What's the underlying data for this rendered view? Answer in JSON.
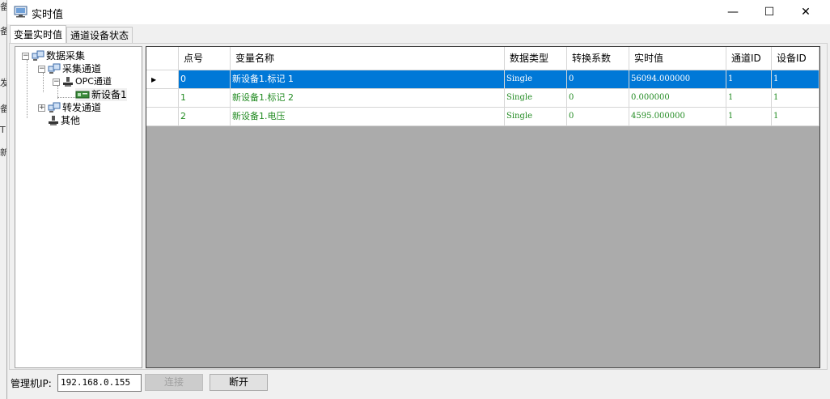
{
  "background_window": {
    "side_chars": [
      "备",
      "备",
      "发",
      "备",
      "T",
      "新"
    ]
  },
  "window": {
    "title": "实时值",
    "controls": {
      "minimize": "—",
      "maximize": "☐",
      "close": "✕"
    }
  },
  "tabs": [
    {
      "label": "变量实时值",
      "active": true
    },
    {
      "label": "通道设备状态",
      "active": false
    }
  ],
  "tree": {
    "root": "数据采集",
    "collect": "采集通道",
    "opc": "OPC通道",
    "device": "新设备1",
    "forward": "转发通道",
    "other": "其他"
  },
  "grid": {
    "columns": [
      "点号",
      "变量名称",
      "数据类型",
      "转换系数",
      "实时值",
      "通道ID",
      "设备ID"
    ],
    "rows": [
      {
        "point": "0",
        "name": "新设备1.标记 1",
        "type": "Single",
        "factor": "0",
        "value": "56094.000000",
        "channel_id": "1",
        "device_id": "1"
      },
      {
        "point": "1",
        "name": "新设备1.标记 2",
        "type": "Single",
        "factor": "0",
        "value": "0.000000",
        "channel_id": "1",
        "device_id": "1"
      },
      {
        "point": "2",
        "name": "新设备1.电压",
        "type": "Single",
        "factor": "0",
        "value": "4595.000000",
        "channel_id": "1",
        "device_id": "1"
      }
    ],
    "selected_row_marker": "▶"
  },
  "bottom": {
    "ip_label": "管理机IP:",
    "ip_value": "192.168.0.155",
    "connect_label": "连接",
    "disconnect_label": "断开"
  }
}
